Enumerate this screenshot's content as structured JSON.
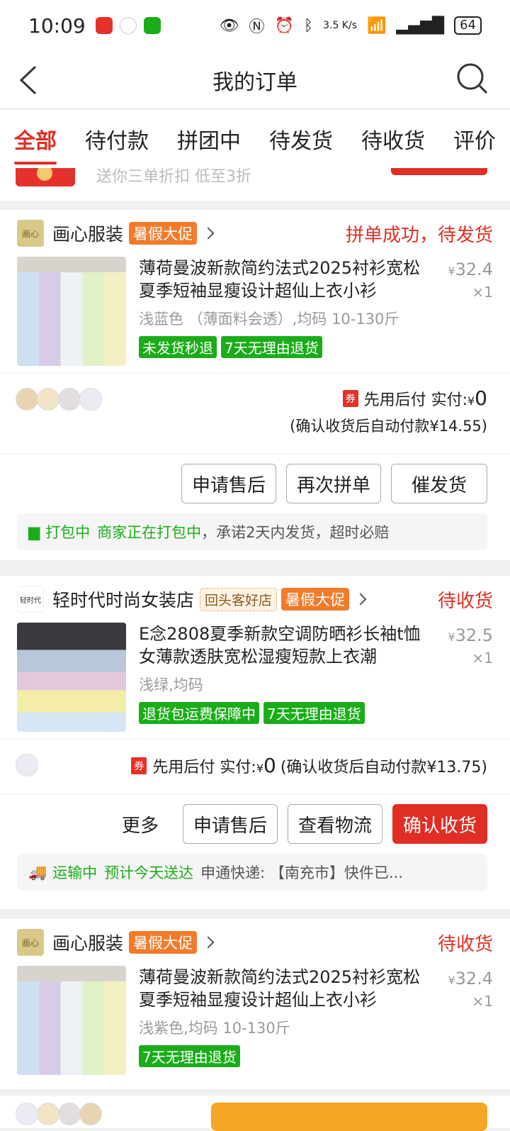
{
  "status_bar": {
    "time": "10:09",
    "net_speed": "3.5 K/s",
    "battery": "64"
  },
  "header": {
    "title": "我的订单"
  },
  "tabs": [
    {
      "label": "全部",
      "active": true
    },
    {
      "label": "待付款"
    },
    {
      "label": "拼团中"
    },
    {
      "label": "待发货"
    },
    {
      "label": "待收货"
    },
    {
      "label": "评价"
    }
  ],
  "promo": {
    "text": "送你三单折扣 低至3折"
  },
  "orders": [
    {
      "shop_logo": "画心",
      "shop_name": "画心服装",
      "sale_badge": "暑假大促",
      "status": "拼单成功，待发货",
      "product_title": "薄荷曼波新款简约法式2025衬衫宽松夏季短袖显瘦设计超仙上衣小衫",
      "spec": "浅蓝色 （薄面料会透）,均码 10-130斤",
      "price": "32.4",
      "qty": "×1",
      "tags": [
        "未发货秒退",
        "7天无理由退货"
      ],
      "pay_label": "先用后付 实付:",
      "paid": "0",
      "coupon": "券",
      "pay_note": "(确认收货后自动付款¥14.55)",
      "buttons": [
        "申请售后",
        "再次拼单",
        "催发货"
      ],
      "ship_status": "打包中",
      "ship_detail": "商家正在打包中",
      "ship_note": "，承诺2天内发货，超时必赔"
    },
    {
      "shop_logo": "轻时代",
      "shop_name": "轻时代时尚女装店",
      "return_badge": "回头客好店",
      "sale_badge": "暑假大促",
      "status": "待收货",
      "product_title": "E念2808夏季新款空调防晒衫长袖t恤女薄款透肤宽松湿瘦短款上衣潮",
      "spec": "浅绿,均码",
      "price": "32.5",
      "qty": "×1",
      "tags": [
        "退货包运费保障中",
        "7天无理由退货"
      ],
      "pay_label": "先用后付 实付:",
      "paid": "0",
      "coupon": "券",
      "pay_note": "(确认收货后自动付款¥13.75)",
      "more": "更多",
      "buttons": [
        "申请售后",
        "查看物流",
        "确认收货"
      ],
      "ship_status": "运输中",
      "ship_detail": "预计今天送达",
      "ship_note": "申通快递: 【南充市】快件已..."
    },
    {
      "shop_logo": "画心",
      "shop_name": "画心服装",
      "sale_badge": "暑假大促",
      "status": "待收货",
      "product_title": "薄荷曼波新款简约法式2025衬衫宽松夏季短袖显瘦设计超仙上衣小衫",
      "spec": "浅紫色,均码 10-130斤",
      "price": "32.4",
      "qty": "×1",
      "tags": [
        "7天无理由退货"
      ]
    }
  ],
  "colors": {
    "accent": "#e02e24",
    "green": "#1aad19",
    "orange": "#f27b2a"
  }
}
